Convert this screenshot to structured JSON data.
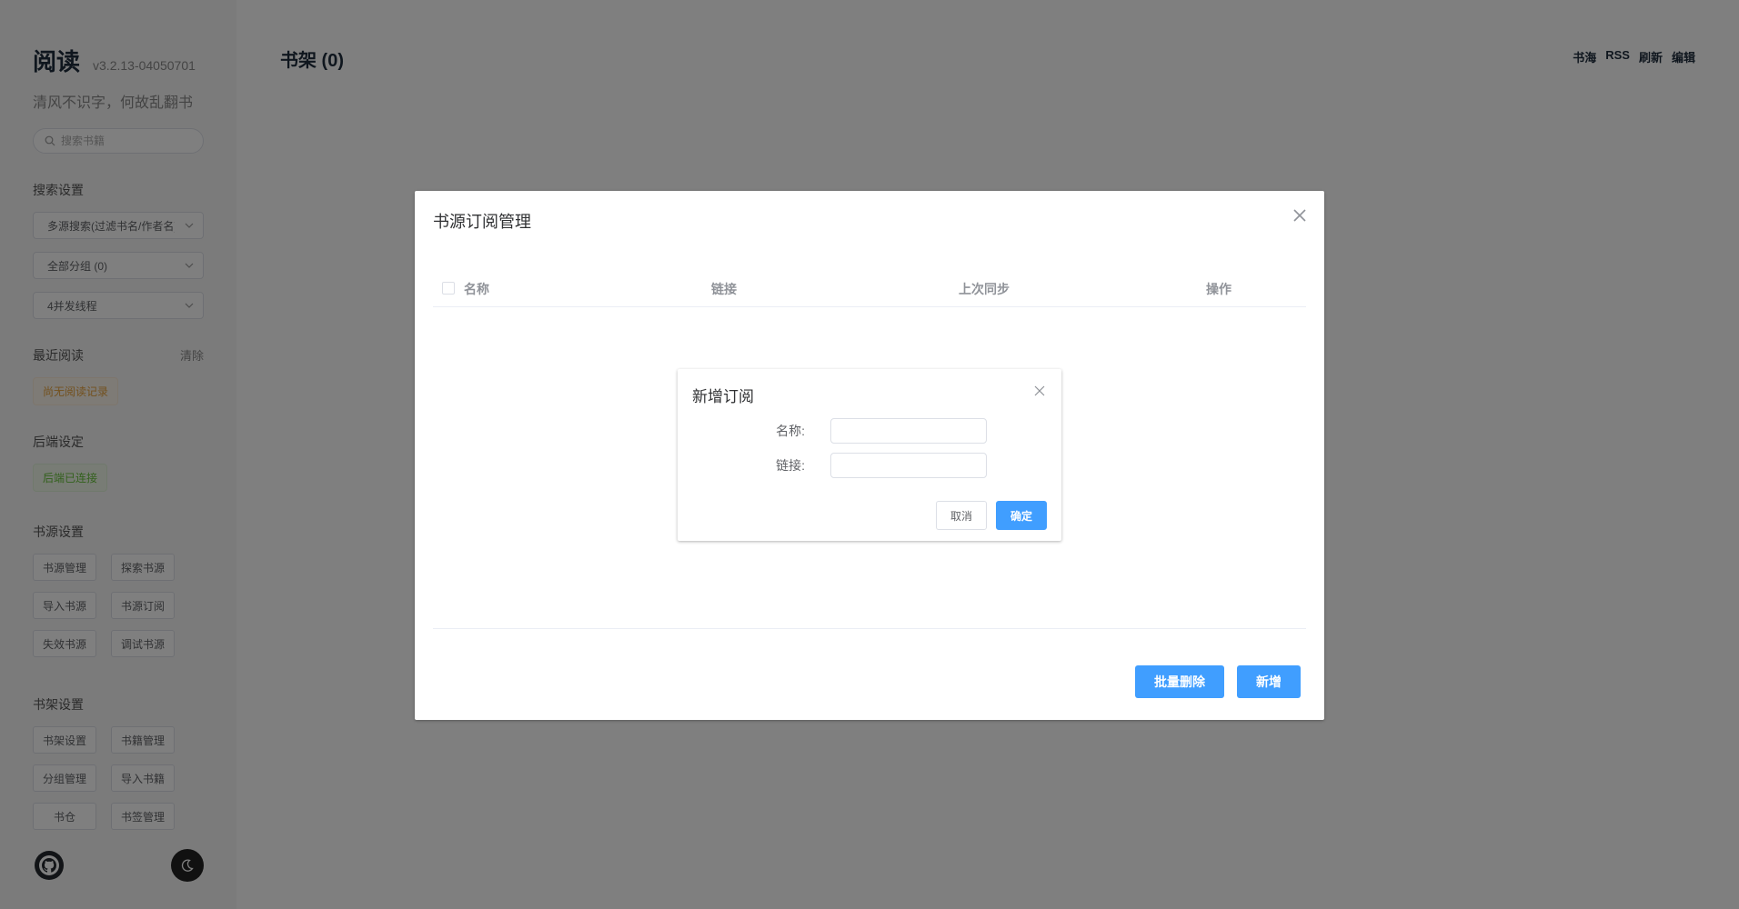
{
  "sidebar": {
    "app_title": "阅读",
    "version": "v3.2.13-04050701",
    "slogan": "清风不识字，何故乱翻书",
    "search_placeholder": "搜索书籍",
    "search_settings": {
      "title": "搜索设置",
      "mode_select": "多源搜索(过滤书名/作者名)",
      "group_select": "全部分组 (0)",
      "thread_select": "4并发线程"
    },
    "recent": {
      "title": "最近阅读",
      "clear_label": "清除",
      "empty_tag": "尚无阅读记录"
    },
    "backend": {
      "title": "后端设定",
      "status_tag": "后端已连接"
    },
    "source_settings": {
      "title": "书源设置",
      "buttons": [
        "书源管理",
        "探索书源",
        "导入书源",
        "书源订阅",
        "失效书源",
        "调试书源"
      ]
    },
    "shelf_settings": {
      "title": "书架设置",
      "buttons": [
        "书架设置",
        "书籍管理",
        "分组管理",
        "导入书籍",
        "书仓",
        "书签管理"
      ]
    }
  },
  "main": {
    "shelf_title": "书架 (0)",
    "nav": [
      "书海",
      "RSS",
      "刷新",
      "编辑"
    ]
  },
  "subscription_dialog": {
    "title": "书源订阅管理",
    "columns": [
      "名称",
      "链接",
      "上次同步",
      "操作"
    ],
    "batch_delete_label": "批量删除",
    "add_label": "新增"
  },
  "add_dialog": {
    "title": "新增订阅",
    "name_label": "名称:",
    "link_label": "链接:",
    "name_value": "",
    "link_value": "",
    "cancel_label": "取消",
    "confirm_label": "确定"
  },
  "colors": {
    "primary": "#409eff",
    "success": "#67c23a",
    "warning": "#e6a23c"
  }
}
